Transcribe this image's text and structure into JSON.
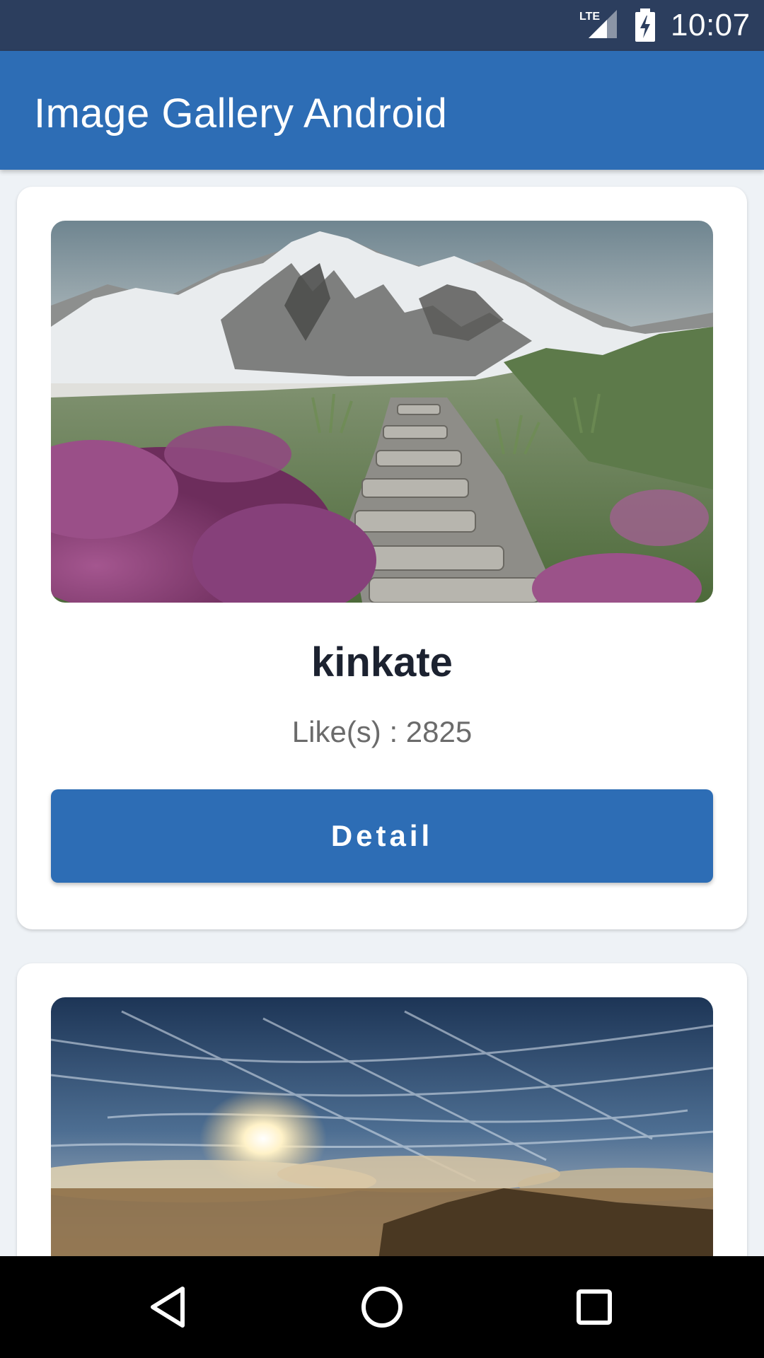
{
  "status_bar": {
    "network": "LTE",
    "time": "10:07"
  },
  "app_bar": {
    "title": "Image Gallery Android"
  },
  "cards": [
    {
      "image": "mountain-path-landscape",
      "title": "kinkate",
      "likes": "Like(s) : 2825",
      "button_label": "Detail"
    },
    {
      "image": "sunset-above-clouds-landscape"
    }
  ],
  "nav_bar": {
    "icons": [
      "back-icon",
      "home-icon",
      "recents-icon"
    ]
  },
  "colors": {
    "status_bar": "#2c3e5e",
    "primary": "#2d6db5",
    "background": "#eef2f6",
    "title_text": "#1c2230",
    "likes_text": "#6b6b6b"
  }
}
